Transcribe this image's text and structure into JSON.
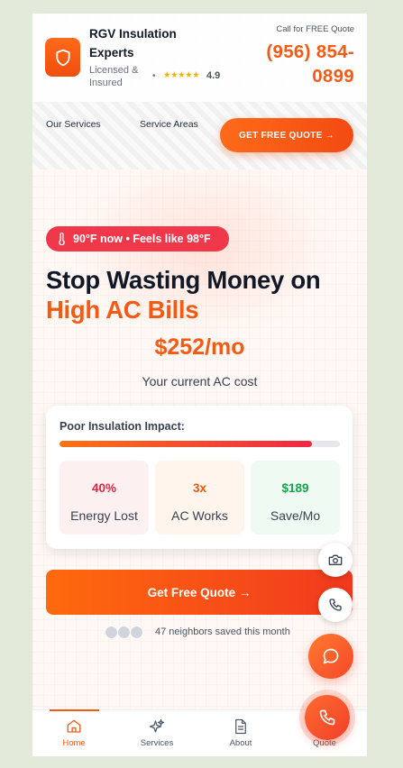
{
  "header": {
    "brand_name": "RGV Insulation Experts",
    "brand_sub": "Licensed & Insured",
    "rating": "4.9",
    "stars": "★★★★★",
    "call_label": "Call for FREE Quote",
    "phone": "(956) 854-0899"
  },
  "nav": {
    "links": [
      "Our Services",
      "Service Areas"
    ],
    "cta": "GET FREE QUOTE →"
  },
  "hero": {
    "temperature": "90°F now • Feels like 98°F",
    "headline": "Stop Wasting Money on",
    "headline_accent": "High AC Bills",
    "cost": "$252/mo",
    "cost_label": "Your current AC cost"
  },
  "impact": {
    "title": "Poor Insulation Impact:",
    "progress_fraction": 0.9,
    "stats": [
      {
        "value": "40%",
        "label": "Energy Lost",
        "color": "#dc2640",
        "bg": "#fdf0f1"
      },
      {
        "value": "3x",
        "label": "AC Works",
        "color": "#ea580c",
        "bg": "#fff5ec"
      },
      {
        "value": "$189",
        "label": "Save/Mo",
        "color": "#16a34a",
        "bg": "#effaf2"
      }
    ]
  },
  "cta": {
    "label": "Get Free Quote →",
    "social_proof": "47 neighbors saved this month"
  },
  "bottom_nav": {
    "items": [
      {
        "label": "Home",
        "icon": "home-icon"
      },
      {
        "label": "Services",
        "icon": "sparkle-icon"
      },
      {
        "label": "About",
        "icon": "document-icon"
      },
      {
        "label": "Quote",
        "icon": "phone-icon"
      }
    ],
    "active": "Home"
  },
  "colors": {
    "brand": "#f35b14",
    "alert": "#f0384a",
    "background": "#e4ead9"
  }
}
